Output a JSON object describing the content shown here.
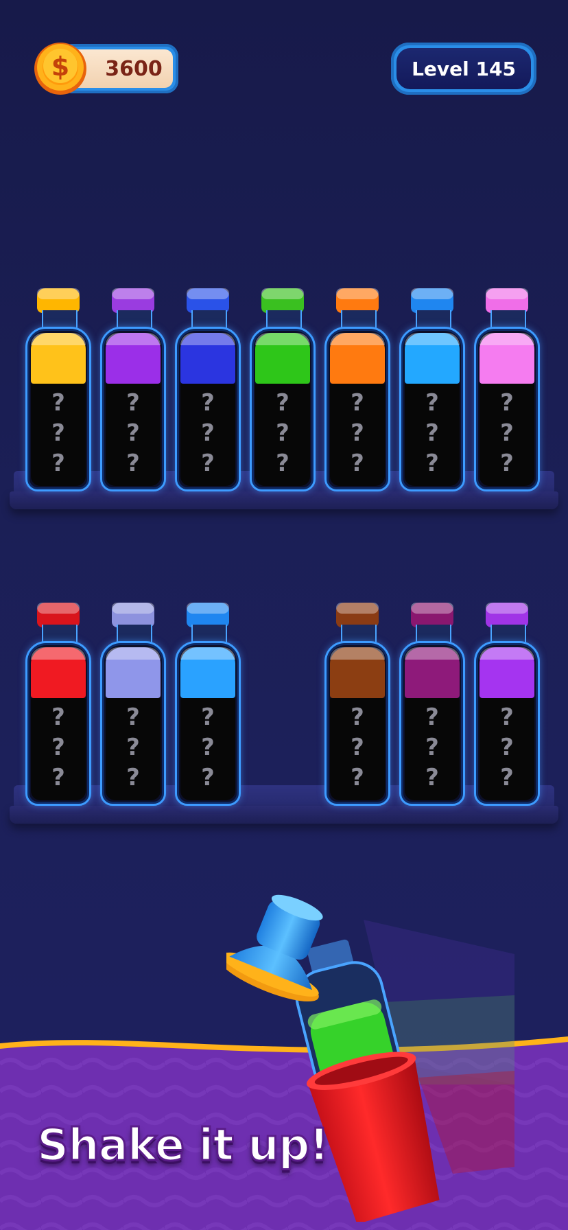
{
  "hud": {
    "coins": "3600",
    "level": "Level 145",
    "coin_symbol": "$"
  },
  "shelves": [
    {
      "bottles": [
        {
          "color": "#ffc21a",
          "cap": "#ffb600",
          "mystery": [
            "?",
            "?",
            "?"
          ]
        },
        {
          "color": "#9b2fe8",
          "cap": "#9a3ce0",
          "mystery": [
            "?",
            "?",
            "?"
          ]
        },
        {
          "color": "#2b35e0",
          "cap": "#2a52e8",
          "mystery": [
            "?",
            "?",
            "?"
          ]
        },
        {
          "color": "#2ec619",
          "cap": "#3ac020",
          "mystery": [
            "?",
            "?",
            "?"
          ]
        },
        {
          "color": "#ff7a10",
          "cap": "#ff7a10",
          "mystery": [
            "?",
            "?",
            "?"
          ]
        },
        {
          "color": "#23a8ff",
          "cap": "#1f86f0",
          "mystery": [
            "?",
            "?",
            "?"
          ]
        },
        {
          "color": "#f57cf0",
          "cap": "#f06ee8",
          "mystery": [
            "?",
            "?",
            "?"
          ]
        }
      ]
    },
    {
      "bottles": [
        {
          "color": "#f01a22",
          "cap": "#d9141c",
          "mystery": [
            "?",
            "?",
            "?"
          ]
        },
        {
          "color": "#8f96ea",
          "cap": "#8d92de",
          "mystery": [
            "?",
            "?",
            "?"
          ]
        },
        {
          "color": "#2aa2ff",
          "cap": "#1f86f0",
          "mystery": [
            "?",
            "?",
            "?"
          ]
        },
        {
          "color": "#8c3e12",
          "cap": "#8a3b14",
          "mystery": [
            "?",
            "?",
            "?"
          ]
        },
        {
          "color": "#8e1a7a",
          "cap": "#8a176f",
          "mystery": [
            "?",
            "?",
            "?"
          ]
        },
        {
          "color": "#a534f0",
          "cap": "#a034e6",
          "mystery": [
            "?",
            "?",
            "?"
          ]
        }
      ]
    }
  ],
  "banner": {
    "text": "Shake it up!"
  }
}
